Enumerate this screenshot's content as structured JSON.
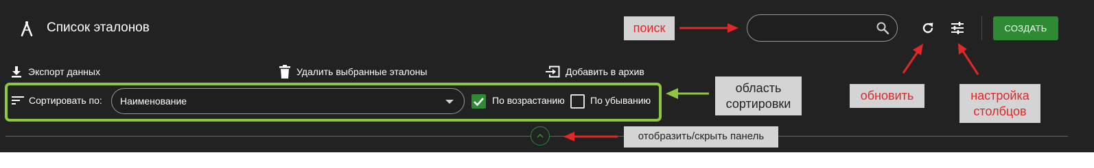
{
  "header": {
    "title": "Список эталонов",
    "app_icon": "compass-icon",
    "search": {
      "value": "",
      "placeholder": ""
    },
    "create_label": "СОЗДАТЬ"
  },
  "toolbar": {
    "export_label": "Экспорт данных",
    "delete_label": "Удалить выбранные эталоны",
    "archive_label": "Добавить в архив"
  },
  "sort": {
    "label": "Сортировать по:",
    "selected": "Наименование",
    "ascending_label": "По возрастанию",
    "ascending_checked": true,
    "descending_label": "По убыванию",
    "descending_checked": false
  },
  "annotations": {
    "search": "поиск",
    "sort_area": "область сортировки",
    "refresh": "обновить",
    "columns": "настройка столбцов",
    "toggle_panel": "отобразить/скрыть панель"
  },
  "colors": {
    "background": "#222222",
    "accent": "#2e8b33",
    "highlight": "#8dc63f",
    "annotation_text": "#e02828",
    "annotation_bg": "#d4d4d4"
  }
}
